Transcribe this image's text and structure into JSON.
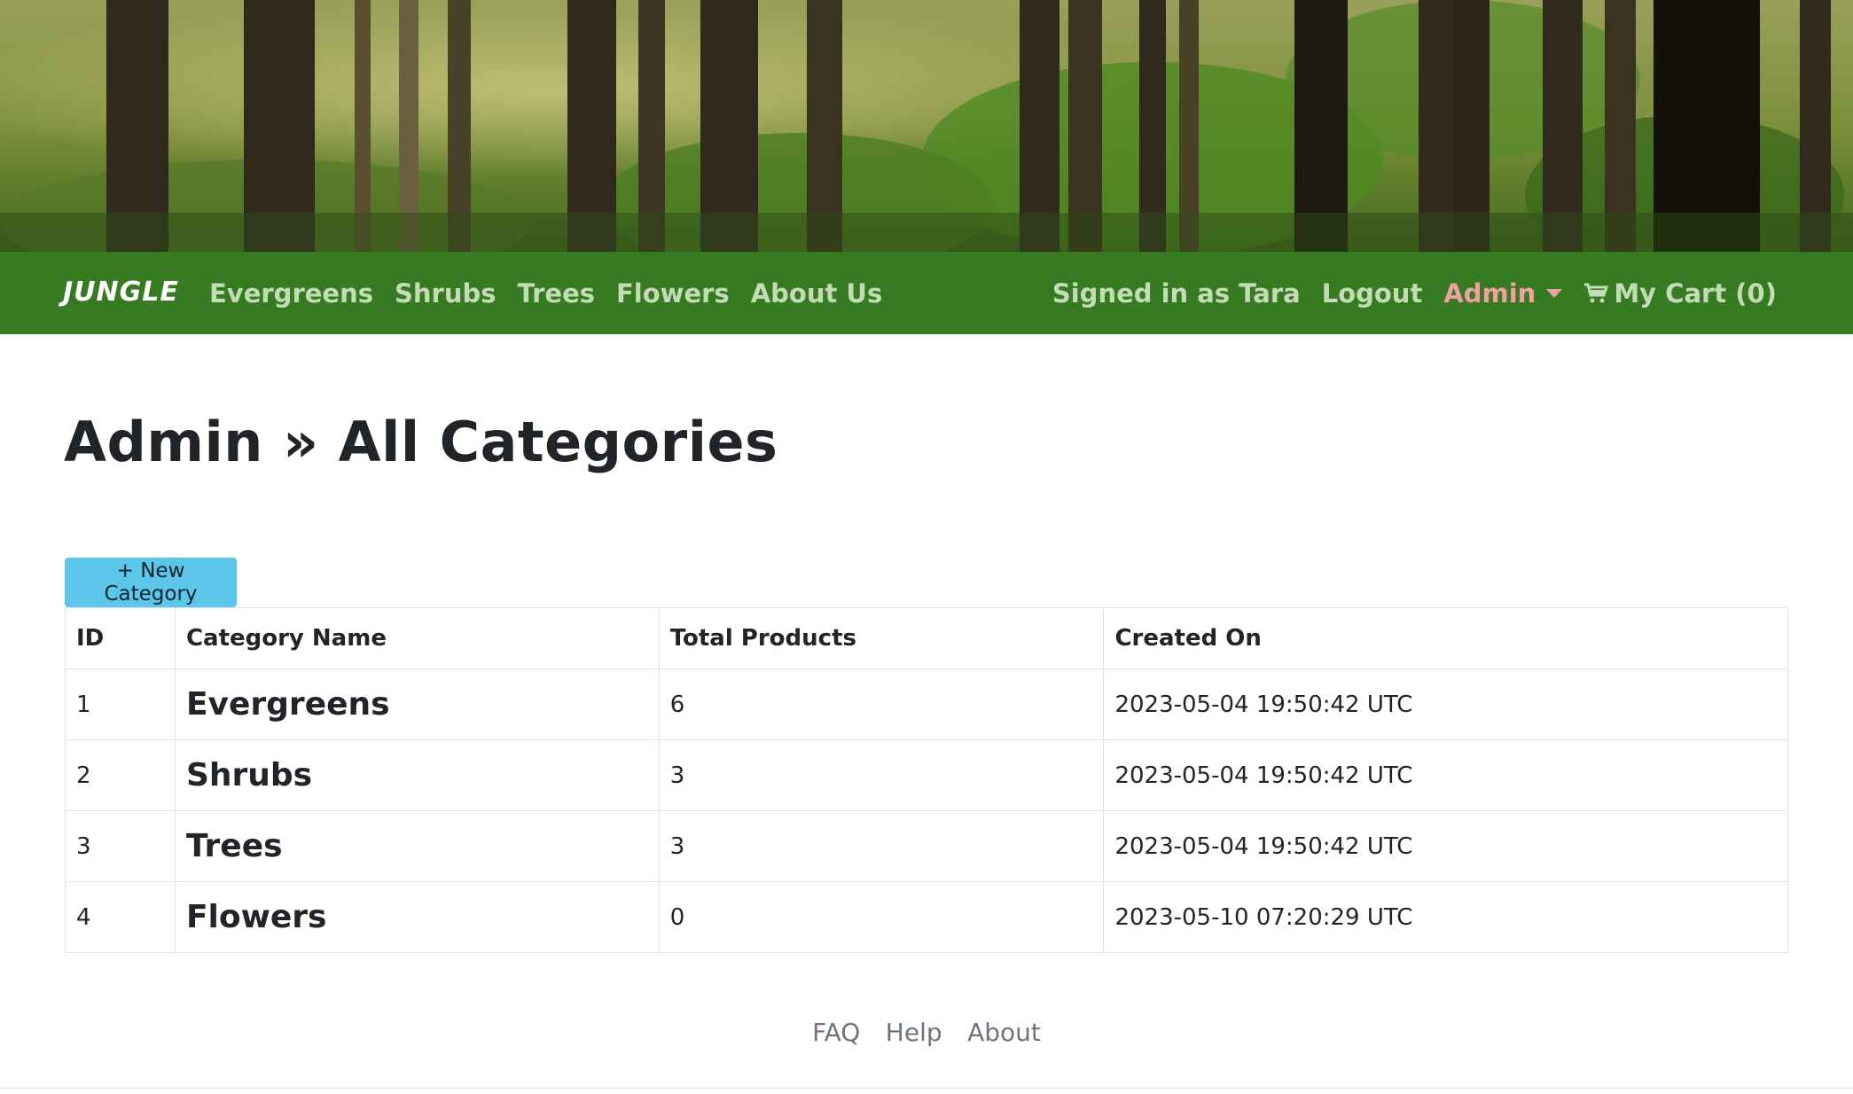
{
  "nav": {
    "brand": "JUNGLE",
    "links": [
      "Evergreens",
      "Shrubs",
      "Trees",
      "Flowers",
      "About Us"
    ],
    "signed_in": "Signed in as Tara",
    "logout": "Logout",
    "admin": "Admin",
    "cart": "My Cart (0)"
  },
  "page": {
    "title": "Admin » All Categories",
    "new_button": "+ New Category"
  },
  "table": {
    "headers": [
      "ID",
      "Category Name",
      "Total Products",
      "Created On"
    ],
    "rows": [
      {
        "id": "1",
        "name": "Evergreens",
        "total": "6",
        "created": "2023-05-04 19:50:42 UTC"
      },
      {
        "id": "2",
        "name": "Shrubs",
        "total": "3",
        "created": "2023-05-04 19:50:42 UTC"
      },
      {
        "id": "3",
        "name": "Trees",
        "total": "3",
        "created": "2023-05-04 19:50:42 UTC"
      },
      {
        "id": "4",
        "name": "Flowers",
        "total": "0",
        "created": "2023-05-10 07:20:29 UTC"
      }
    ]
  },
  "footer": {
    "links": [
      "FAQ",
      "Help",
      "About"
    ]
  },
  "colors": {
    "navbar": "#367a22",
    "nav_link": "#c3dcb6",
    "admin_link": "#f0a0a0",
    "button": "#5bc5ea"
  }
}
